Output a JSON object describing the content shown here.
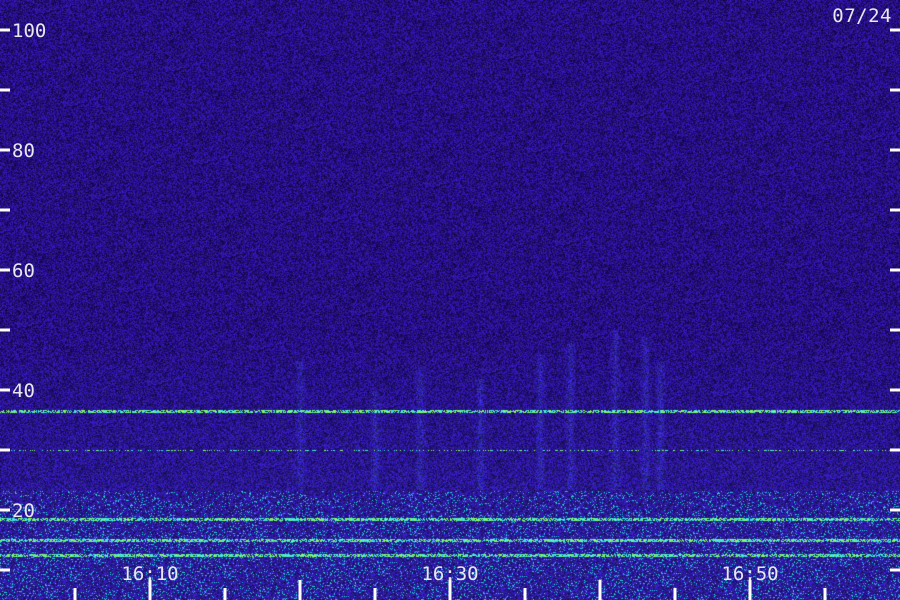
{
  "date_label": "07/24",
  "chart_data": {
    "type": "heatmap",
    "title": "",
    "xlabel": "",
    "ylabel": "",
    "y_ticks_labeled": [
      20,
      40,
      60,
      80,
      100
    ],
    "y_ticks_minor": [
      10,
      30,
      50,
      70,
      90
    ],
    "ylim": [
      10,
      105
    ],
    "x_tick_labels": [
      "16:10",
      "16:30",
      "16:50"
    ],
    "xlim_minutes": [
      "16:00",
      "17:00"
    ],
    "colors": {
      "background": "#1a0f7a",
      "noise_dark": "#0a0530",
      "noise_light": "#3a2ac8",
      "band_cyan": "#2fd8e0",
      "band_green": "#9cff5a",
      "axis": "#ffffff"
    },
    "horizontal_bands": [
      {
        "value": 36.5,
        "intensity": "medium"
      },
      {
        "value": 18.5,
        "intensity": "high"
      },
      {
        "value": 15,
        "intensity": "high"
      },
      {
        "value": 12.5,
        "intensity": "high"
      },
      {
        "value": 30,
        "intensity": "low"
      }
    ],
    "vertical_bursts": [
      {
        "time": "16:20",
        "fmax": 45
      },
      {
        "time": "16:25",
        "fmax": 40
      },
      {
        "time": "16:28",
        "fmax": 44
      },
      {
        "time": "16:32",
        "fmax": 42
      },
      {
        "time": "16:36",
        "fmax": 46
      },
      {
        "time": "16:38",
        "fmax": 48
      },
      {
        "time": "16:41",
        "fmax": 50
      },
      {
        "time": "16:43",
        "fmax": 49
      },
      {
        "time": "16:44",
        "fmax": 45
      }
    ]
  }
}
